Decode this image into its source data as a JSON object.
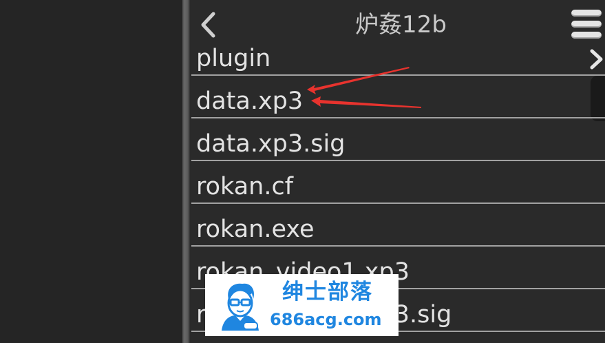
{
  "header": {
    "title": "炉姦12b",
    "back_icon": "chevron-left-icon",
    "menu_icon": "hamburger-menu-icon",
    "forward_icon": "chevron-right-icon"
  },
  "files": [
    {
      "name": "plugin"
    },
    {
      "name": "data.xp3"
    },
    {
      "name": "data.xp3.sig"
    },
    {
      "name": "rokan.cf"
    },
    {
      "name": "rokan.exe"
    },
    {
      "name": "rokan_video1.xp3"
    },
    {
      "name": "rokan_video1.xp3.sig"
    }
  ],
  "annotation": {
    "color": "#e8332e",
    "target": "data.xp3"
  },
  "watermark": {
    "title": "绅士部落",
    "url": "686acg.com",
    "color": "#1f86e0"
  },
  "colors": {
    "background": "#262626",
    "text": "#e3e3e3",
    "rule": "#a2a2a2"
  }
}
